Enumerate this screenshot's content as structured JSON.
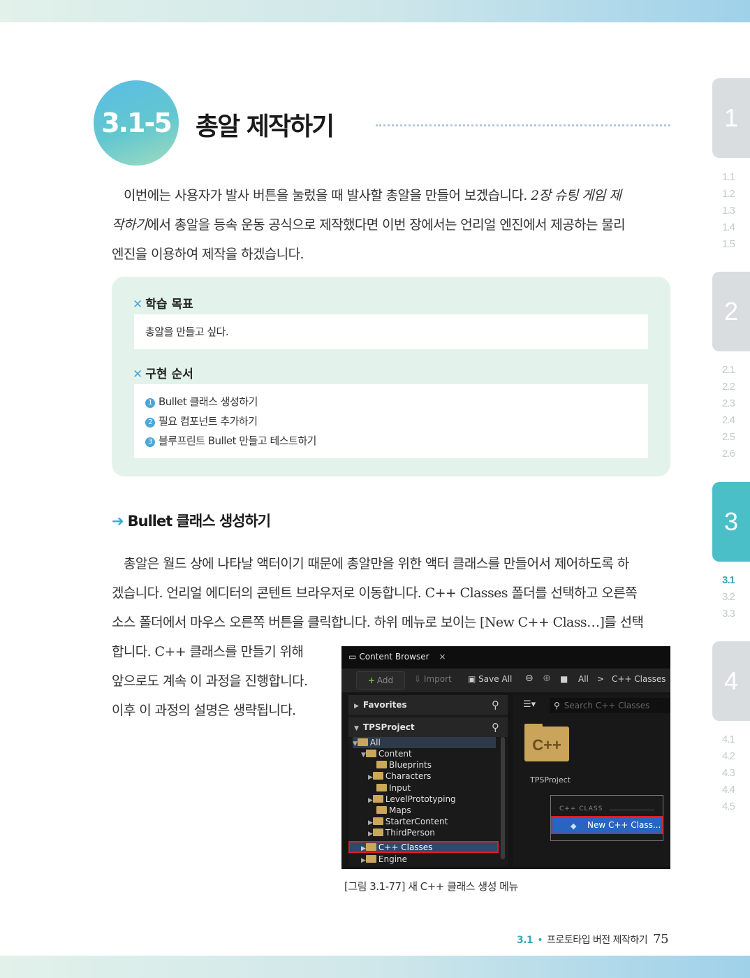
{
  "section": {
    "number": "3.1-5",
    "title": "총알 제작하기"
  },
  "side_tabs": [
    {
      "label": "1",
      "subs": [
        "1.1",
        "1.2",
        "1.3",
        "1.4",
        "1.5"
      ]
    },
    {
      "label": "2",
      "subs": [
        "2.1",
        "2.2",
        "2.3",
        "2.4",
        "2.5",
        "2.6"
      ]
    },
    {
      "label": "3",
      "subs": [
        "3.1",
        "3.2",
        "3.3"
      ]
    },
    {
      "label": "4",
      "subs": [
        "4.1",
        "4.2",
        "4.3",
        "4.4",
        "4.5"
      ]
    }
  ],
  "intro": {
    "line1_a": "이번에는 사용자가 발사 버튼을 눌렀을 때 발사할 총알을 만들어 보겠습니다. ",
    "line1_em": "2장 슈팅 게임 제",
    "line2_em": "작하기",
    "line2_b": "에서 총알을 등속 운동 공식으로 제작했다면 이번 장에서는 언리얼 엔진에서 제공하는 물리",
    "line3": "엔진을 이용하여 제작을 하겠습니다."
  },
  "goal_box": {
    "goal_title": "학습 목표",
    "goal_text": "총알을 만들고 싶다.",
    "steps_title": "구현 순서",
    "steps": [
      "Bullet 클래스 생성하기",
      "필요 컴포넌트 추가하기",
      "블루프린트 Bullet 만들고 테스트하기"
    ]
  },
  "subheading": "Bullet 클래스 생성하기",
  "body": {
    "line1": "총알은 월드 상에 나타날 액터이기 때문에 총알만을 위한 액터 클래스를 만들어서 제어하도록 하",
    "line2": "겠습니다. 언리얼 에디터의 콘텐트 브라우저로 이동합니다. C++ Classes 폴더를 선택하고 오른쪽",
    "line3": "소스 폴더에서 마우스 오른쪽 버튼을 클릭합니다. 하위 메뉴로 보이는 [New C++ Class…]를 선택",
    "line4": "합니다. C++ 클래스를 만들기 위해",
    "line5": "앞으로도 계속 이 과정을 진행합니다.",
    "line6": "이후 이 과정의 설명은 생략됩니다."
  },
  "screenshot": {
    "tab_title": "Content Browser",
    "tab_close": "×",
    "toolbar": {
      "add": "Add",
      "import": "Import",
      "save_all": "Save All",
      "path_all": "All",
      "path_sep": ">",
      "path_current": "C++ Classes"
    },
    "favorites": "Favorites",
    "project": "TPSProject",
    "search_placeholder": "Search C++ Classes",
    "tree": [
      "All",
      "Content",
      "Blueprints",
      "Characters",
      "Input",
      "LevelPrototyping",
      "Maps",
      "StarterContent",
      "ThirdPerson",
      "C++ Classes",
      "Engine"
    ],
    "cpp_icon_text": "C++",
    "cpp_folder_label": "TPSProject",
    "context_header": "C++ CLASS",
    "context_item": "New C++ Class..."
  },
  "caption": "[그림 3.1-77] 새 C++ 클래스 생성 메뉴",
  "footer": {
    "section": "3.1",
    "title": "프로토타입 버전 제작하기",
    "page": "75"
  }
}
